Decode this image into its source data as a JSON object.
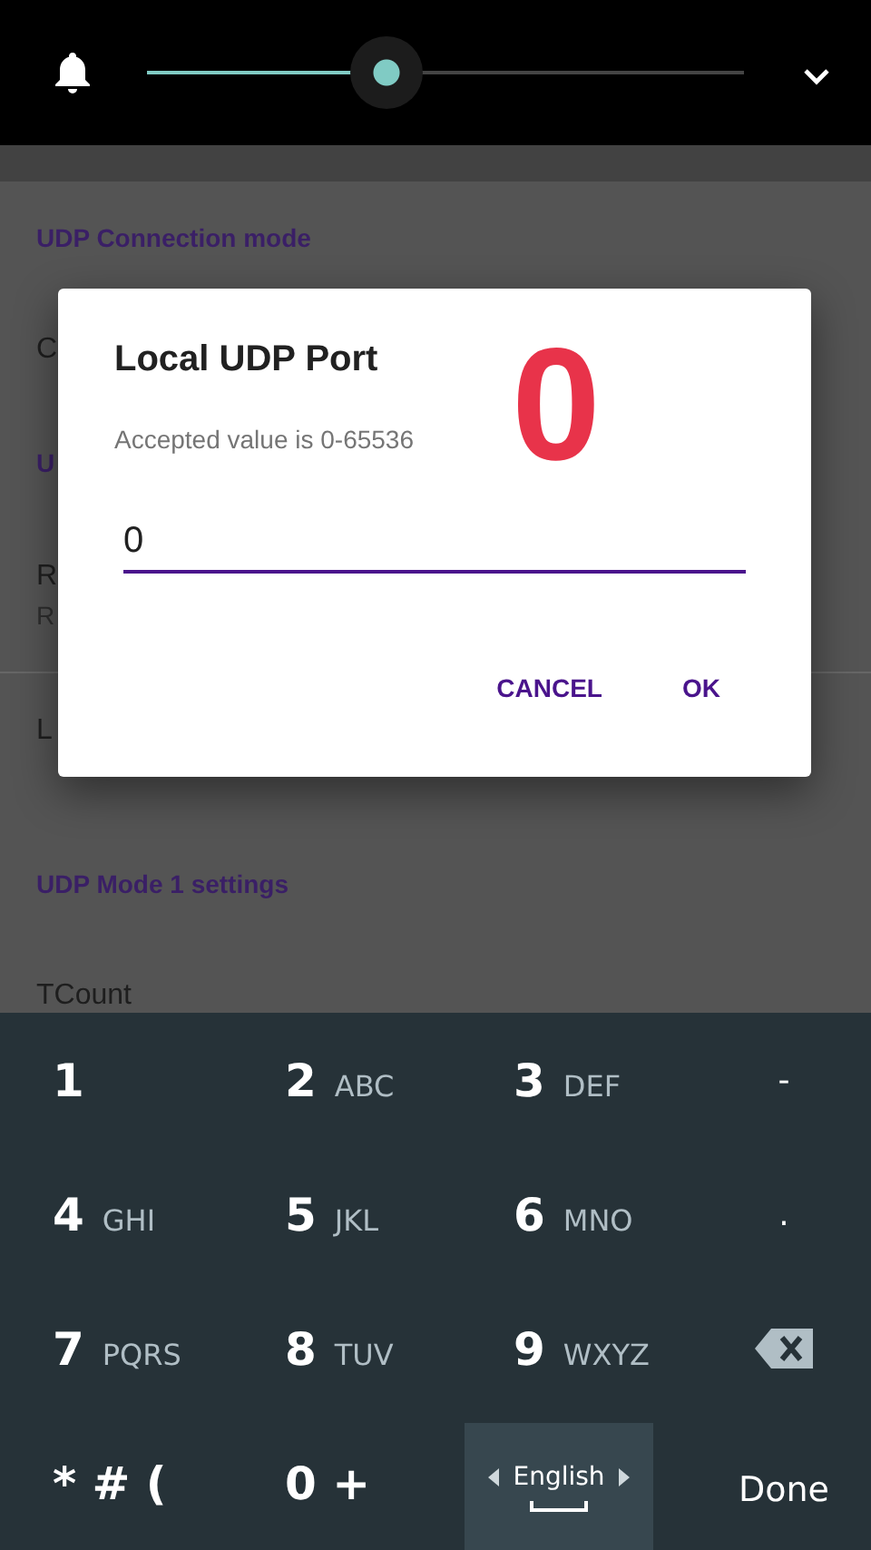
{
  "volume_bar": {
    "level": 0.4
  },
  "settings": [
    {
      "kind": "header",
      "title": "UDP Connection mode"
    },
    {
      "kind": "item",
      "title": "C"
    },
    {
      "kind": "header",
      "title": "U"
    },
    {
      "kind": "item",
      "title": "R",
      "summary": "R",
      "divider": true
    },
    {
      "kind": "item",
      "title": "L"
    },
    {
      "kind": "header",
      "title": "UDP Mode 1 settings"
    },
    {
      "kind": "item",
      "title": "TCount"
    }
  ],
  "dialog": {
    "title": "Local UDP Port",
    "message": "Accepted value is 0-65536",
    "value": "0",
    "mark": "0",
    "buttons": [
      "CANCEL",
      "OK"
    ]
  },
  "keyboard": {
    "keys": [
      {
        "kind": "digit",
        "digit": "1"
      },
      {
        "kind": "digit",
        "digit": "2",
        "letters": "ABC"
      },
      {
        "kind": "digit",
        "digit": "3",
        "letters": "DEF"
      },
      {
        "kind": "symbol",
        "label": "-"
      },
      {
        "kind": "digit",
        "digit": "4",
        "letters": "GHI"
      },
      {
        "kind": "digit",
        "digit": "5",
        "letters": "JKL"
      },
      {
        "kind": "digit",
        "digit": "6",
        "letters": "MNO"
      },
      {
        "kind": "symbol",
        "label": "."
      },
      {
        "kind": "digit",
        "digit": "7",
        "letters": "PQRS"
      },
      {
        "kind": "digit",
        "digit": "8",
        "letters": "TUV"
      },
      {
        "kind": "digit",
        "digit": "9",
        "letters": "WXYZ"
      },
      {
        "kind": "backspace"
      },
      {
        "kind": "digit",
        "digit": "* # ("
      },
      {
        "kind": "digit",
        "digit": "0 +"
      },
      {
        "kind": "language",
        "label": "English"
      },
      {
        "kind": "action",
        "label": "Done"
      }
    ]
  }
}
